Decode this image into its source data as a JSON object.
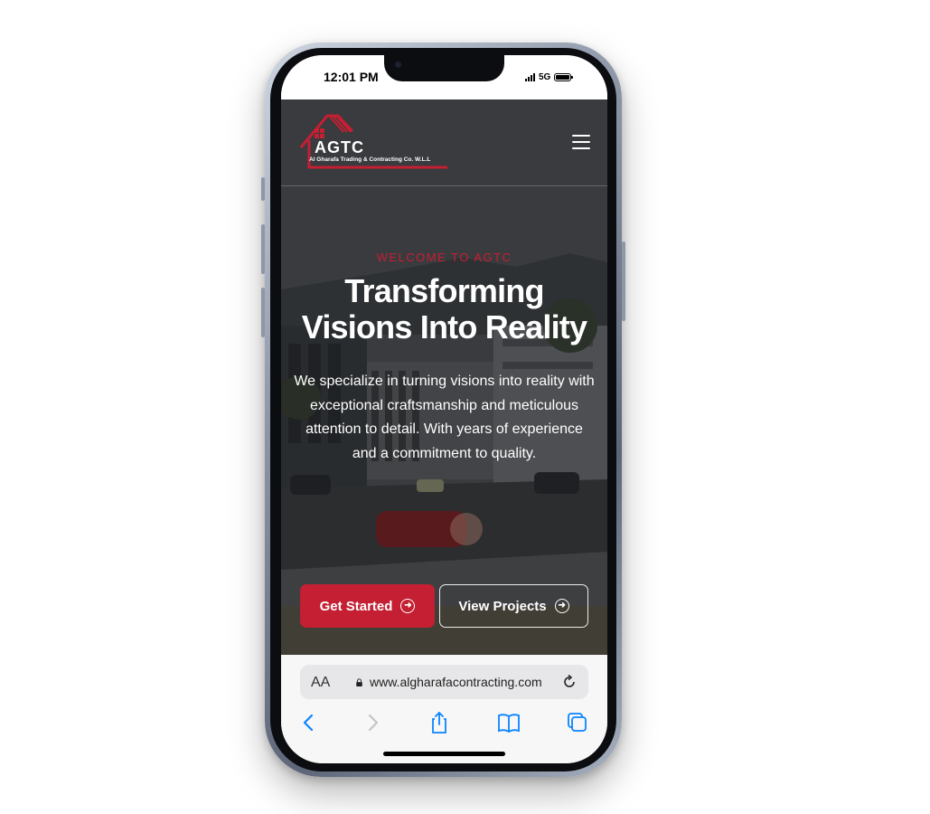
{
  "status_bar": {
    "time": "12:01 PM",
    "network": "5G"
  },
  "header": {
    "logo_text": "AGTC",
    "logo_subtitle": "Al Gharafa Trading & Contracting Co. W.L.L",
    "menu_icon": "hamburger-menu-icon"
  },
  "hero": {
    "eyebrow": "WELCOME TO AGTC",
    "headline_line1": "Transforming",
    "headline_line2": "Visions Into Reality",
    "lead": "We specialize in turning visions into reality with exceptional craftsmanship and meticulous attention to detail. With years of experience and a commitment to quality.",
    "primary_button": "Get Started",
    "secondary_button": "View Projects",
    "button_icon": "arrow-right-circle-icon"
  },
  "browser": {
    "text_size_label": "AA",
    "url": "www.algharafacontracting.com",
    "icons": [
      "lock-icon",
      "reload-icon",
      "back-icon",
      "forward-icon",
      "share-icon",
      "bookmarks-icon",
      "tabs-icon"
    ]
  },
  "colors": {
    "brand_red": "#c41f32",
    "eyebrow_red": "#c81f33",
    "ios_blue": "#0a84ff",
    "frame": "#8d97a8"
  }
}
